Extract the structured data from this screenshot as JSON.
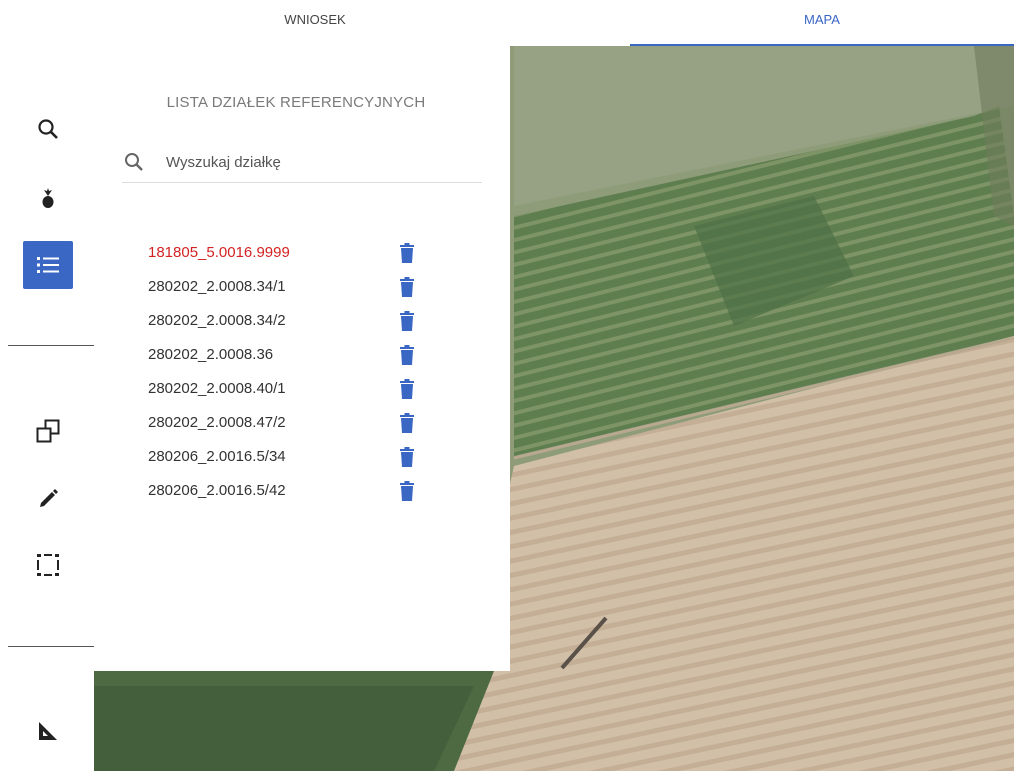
{
  "tabs": [
    {
      "label": "WNIOSEK",
      "active": false
    },
    {
      "label": "MAPA",
      "active": true
    }
  ],
  "accent_color": "#3a66c4",
  "highlight_color": "#d32222",
  "toolbar": {
    "tools": [
      {
        "icon": "search-icon"
      },
      {
        "icon": "plant-icon"
      },
      {
        "icon": "list-icon",
        "active": true
      },
      {
        "icon": "copy-square-icon"
      },
      {
        "icon": "pencil-icon"
      },
      {
        "icon": "selection-box-icon"
      },
      {
        "icon": "ruler-triangle-icon"
      }
    ]
  },
  "panel": {
    "title": "LISTA DZIAŁEK REFERENCYJNYCH",
    "search_placeholder": "Wyszukaj działkę",
    "items": [
      {
        "label": "181805_5.0016.9999",
        "highlighted": true
      },
      {
        "label": "280202_2.0008.34/1",
        "highlighted": false
      },
      {
        "label": "280202_2.0008.34/2",
        "highlighted": false
      },
      {
        "label": "280202_2.0008.36",
        "highlighted": false
      },
      {
        "label": "280202_2.0008.40/1",
        "highlighted": false
      },
      {
        "label": "280202_2.0008.47/2",
        "highlighted": false
      },
      {
        "label": "280206_2.0016.5/34",
        "highlighted": false
      },
      {
        "label": "280206_2.0016.5/42",
        "highlighted": false
      }
    ],
    "delete_icon": "trash-icon"
  }
}
